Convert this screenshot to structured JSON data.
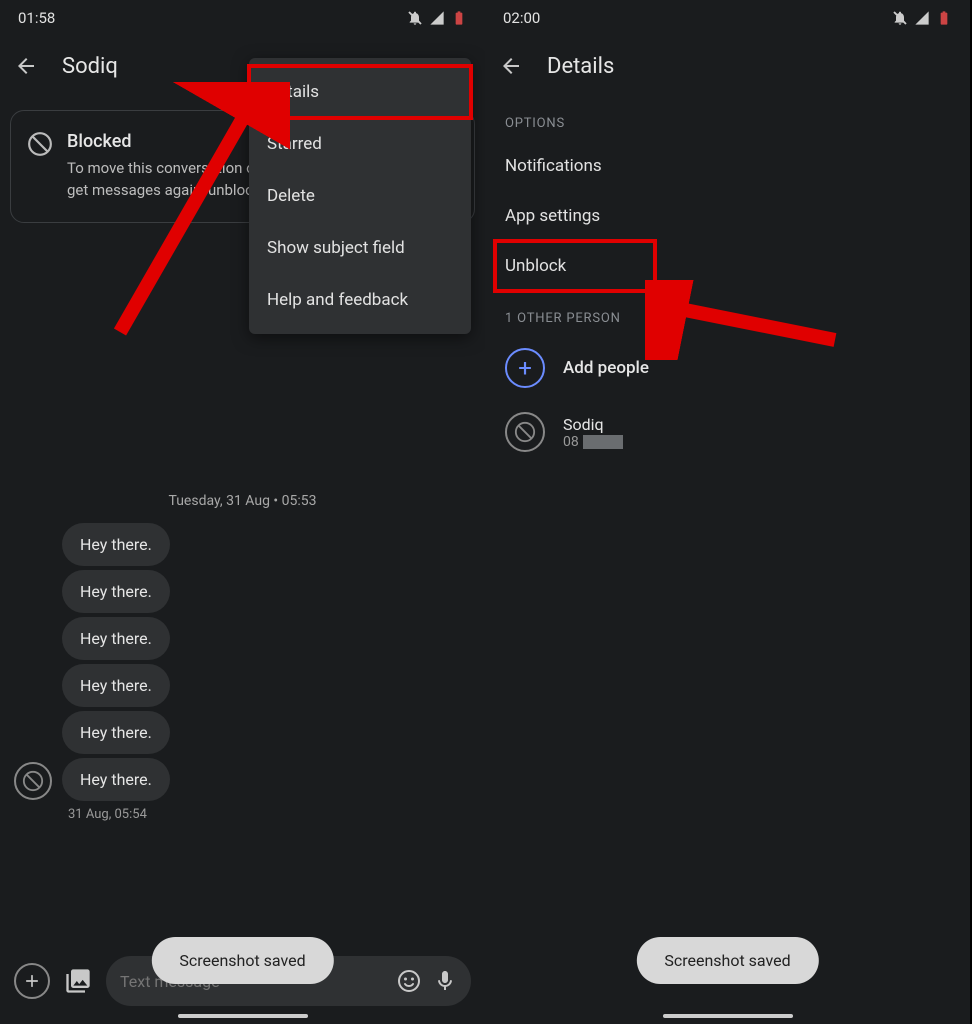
{
  "left": {
    "status": {
      "time": "01:58"
    },
    "title": "Sodiq",
    "blocked": {
      "title": "Blocked",
      "desc": "To move this conversation out of 'Spam and blocked' and get messages again, unblock."
    },
    "menu": {
      "items": [
        "Details",
        "Starred",
        "Delete",
        "Show subject field",
        "Help and feedback"
      ]
    },
    "timestamp": "Tuesday, 31 Aug • 05:53",
    "messages": [
      "Hey there.",
      "Hey there.",
      "Hey there.",
      "Hey there.",
      "Hey there.",
      "Hey there."
    ],
    "msg_time": "31 Aug, 05:54",
    "compose_placeholder": "Text message",
    "toast": "Screenshot saved"
  },
  "right": {
    "status": {
      "time": "02:00"
    },
    "title": "Details",
    "options_header": "OPTIONS",
    "options": [
      "Notifications",
      "App settings",
      "Unblock"
    ],
    "people_header": "1 OTHER PERSON",
    "add_people": "Add people",
    "contact": {
      "name": "Sodiq",
      "number_prefix": "08"
    },
    "toast": "Screenshot saved"
  }
}
